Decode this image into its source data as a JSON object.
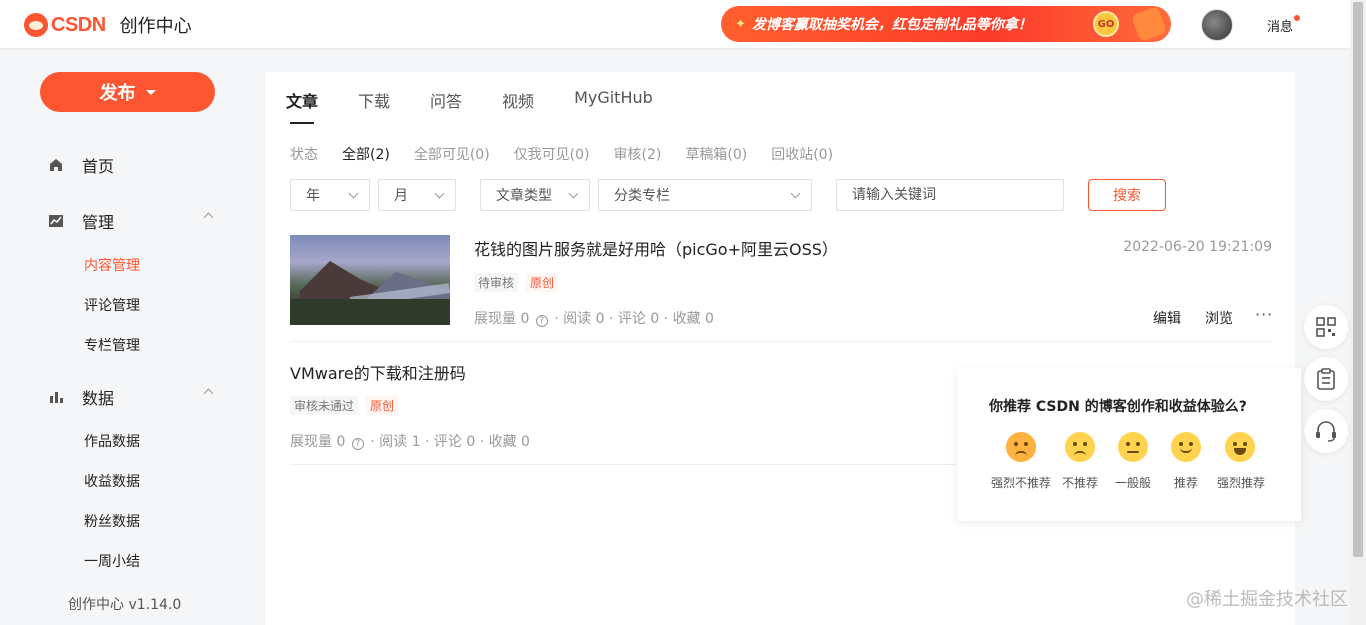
{
  "topbar": {
    "brand": "CSDN",
    "subtitle": "创作中心",
    "banner_text": "发博客赢取抽奖机会，红包定制礼品等你拿！",
    "banner_badge": "GO",
    "messages_label": "消息"
  },
  "sidebar": {
    "publish_label": "发布",
    "home_label": "首页",
    "manage_label": "管理",
    "manage_items": [
      "内容管理",
      "评论管理",
      "专栏管理"
    ],
    "data_label": "数据",
    "data_items": [
      "作品数据",
      "收益数据",
      "粉丝数据",
      "一周小结"
    ],
    "version": "创作中心 v1.14.0"
  },
  "tabs": [
    "文章",
    "下载",
    "问答",
    "视频",
    "MyGitHub"
  ],
  "filters": {
    "status_label": "状态",
    "items": [
      "全部(2)",
      "全部可见(0)",
      "仅我可见(0)",
      "审核(2)",
      "草稿箱(0)",
      "回收站(0)"
    ]
  },
  "selects": {
    "year": "年",
    "month": "月",
    "type": "文章类型",
    "column": "分类专栏"
  },
  "search": {
    "placeholder": "请输入关键词",
    "button": "搜索"
  },
  "articles": [
    {
      "title": "花钱的图片服务就是好用哈（picGo+阿里云OSS）",
      "date": "2022-06-20 19:21:09",
      "status_tag": "待审核",
      "origin_tag": "原创",
      "impressions": "展现量 0",
      "reads": "阅读 0",
      "comments": "评论 0",
      "favorites": "收藏 0",
      "edit": "编辑",
      "browse": "浏览",
      "more": "···"
    },
    {
      "title": "VMware的下载和注册码",
      "status_tag": "审核未通过",
      "origin_tag": "原创",
      "impressions": "展现量 0",
      "reads": "阅读 1",
      "comments": "评论 0",
      "favorites": "收藏 0"
    }
  ],
  "feedback": {
    "question": "你推荐 CSDN 的博客创作和收益体验么?",
    "options": [
      "强烈不推荐",
      "不推荐",
      "一般般",
      "推荐",
      "强烈推荐"
    ]
  },
  "watermark": "@稀土掘金技术社区",
  "colors": {
    "accent": "#fc5531"
  }
}
